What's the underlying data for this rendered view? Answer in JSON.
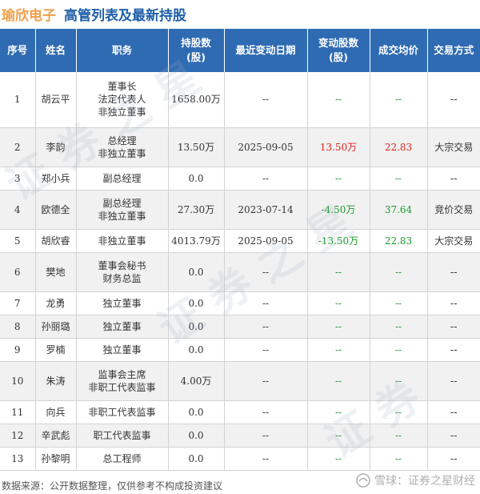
{
  "title": {
    "company": "瑜欣电子",
    "main": "高管列表及最新持股"
  },
  "headers": {
    "seq": "序号",
    "name": "姓名",
    "role": "职务",
    "shares_l1": "持股数",
    "shares_l2": "(股)",
    "date": "最近变动日期",
    "change_l1": "变动股数",
    "change_l2": "(股)",
    "price": "成交均价",
    "method": "交易方式"
  },
  "rows": [
    {
      "seq": "1",
      "name": "胡云平",
      "role": [
        "董事长",
        "法定代表人",
        "非独立董事"
      ],
      "shares": "1658.00万",
      "date": "--",
      "change": "--",
      "price": "--",
      "method": "--"
    },
    {
      "seq": "2",
      "name": "李韵",
      "role": [
        "总经理",
        "非独立董事"
      ],
      "shares": "13.50万",
      "date": "2025-09-05",
      "change": "13.50万",
      "price": "22.83",
      "method": "大宗交易"
    },
    {
      "seq": "3",
      "name": "郑小兵",
      "role": [
        "副总经理"
      ],
      "shares": "0.0",
      "date": "--",
      "change": "--",
      "price": "--",
      "method": "--"
    },
    {
      "seq": "4",
      "name": "欧德全",
      "role": [
        "副总经理",
        "非独立董事"
      ],
      "shares": "27.30万",
      "date": "2023-07-14",
      "change": "-4.50万",
      "price": "37.64",
      "method": "竞价交易"
    },
    {
      "seq": "5",
      "name": "胡欣睿",
      "role": [
        "非独立董事"
      ],
      "shares": "4013.79万",
      "date": "2025-09-05",
      "change": "-13.50万",
      "price": "22.83",
      "method": "大宗交易"
    },
    {
      "seq": "6",
      "name": "樊地",
      "role": [
        "董事会秘书",
        "财务总监"
      ],
      "shares": "0.0",
      "date": "--",
      "change": "--",
      "price": "--",
      "method": "--"
    },
    {
      "seq": "7",
      "name": "龙勇",
      "role": [
        "独立董事"
      ],
      "shares": "0.0",
      "date": "--",
      "change": "--",
      "price": "--",
      "method": "--"
    },
    {
      "seq": "8",
      "name": "孙丽璐",
      "role": [
        "独立董事"
      ],
      "shares": "0.0",
      "date": "--",
      "change": "--",
      "price": "--",
      "method": "--"
    },
    {
      "seq": "9",
      "name": "罗楠",
      "role": [
        "独立董事"
      ],
      "shares": "0.0",
      "date": "--",
      "change": "--",
      "price": "--",
      "method": "--"
    },
    {
      "seq": "10",
      "name": "朱涛",
      "role": [
        "监事会主席",
        "非职工代表监事"
      ],
      "shares": "4.00万",
      "date": "--",
      "change": "--",
      "price": "--",
      "method": "--"
    },
    {
      "seq": "11",
      "name": "向兵",
      "role": [
        "非职工代表监事"
      ],
      "shares": "0.0",
      "date": "--",
      "change": "--",
      "price": "--",
      "method": "--"
    },
    {
      "seq": "12",
      "name": "辛武彪",
      "role": [
        "职工代表监事"
      ],
      "shares": "0.0",
      "date": "--",
      "change": "--",
      "price": "--",
      "method": "--"
    },
    {
      "seq": "13",
      "name": "孙黎明",
      "role": [
        "总工程师"
      ],
      "shares": "0.0",
      "date": "--",
      "change": "--",
      "price": "--",
      "method": "--"
    }
  ],
  "colors": {
    "header_bg": "#2f6bb2",
    "company": "#f0a04b",
    "title": "#1f5fa8",
    "positive": "#e02020",
    "negative": "#1a9b2a"
  },
  "footer": {
    "note": "数据来源：公开数据整理，仅供参考不构成投资建议",
    "brand": "雪球：证券之星财经"
  }
}
